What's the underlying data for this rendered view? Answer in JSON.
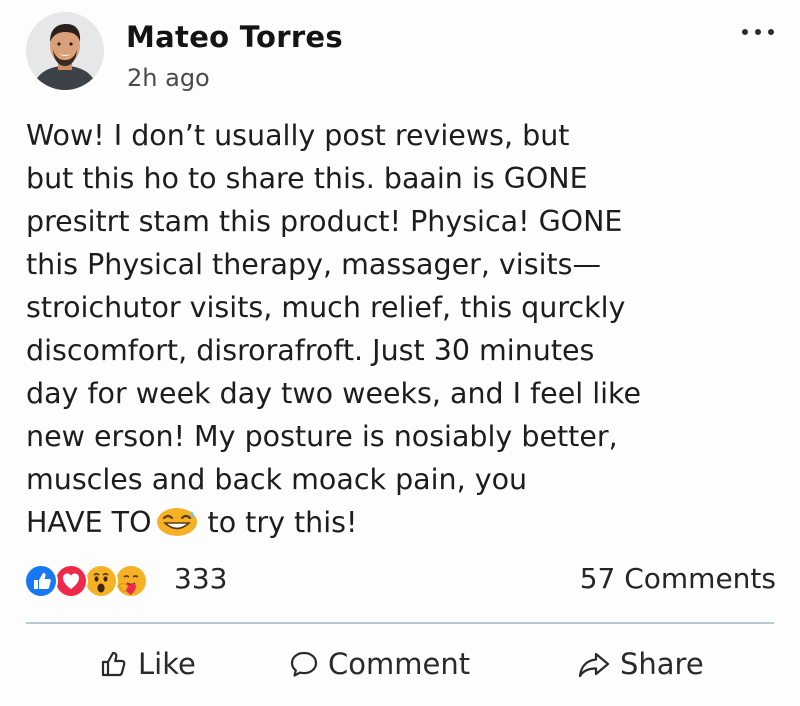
{
  "post": {
    "author": "Mateo Torres",
    "timestamp": "2h ago",
    "body_lines": [
      "Wow! I don’t usually post reviews, but",
      "but this ho to share this. baain is GONE",
      "presitrt stam this product! Physica! GONE",
      "this Physical therapy, massager, visits—",
      "stroichutor visits, much relief, this qurckly",
      "discomfort, disrorafroft. Just 30 minutes",
      "day for week day two weeks, and I feel like",
      "new erson! My posture is nosiably better,",
      "muscles and back moack pain, you"
    ],
    "last_line_before_emoji": "HAVE TO",
    "last_line_after_emoji": "to try this!",
    "inline_emoji": "grinning-sweat-emoji"
  },
  "stats": {
    "reactions": [
      "like-icon",
      "love-icon",
      "wow-icon",
      "care-icon"
    ],
    "reaction_count": "333",
    "comments": "57 Comments"
  },
  "actions": {
    "like": "Like",
    "comment": "Comment",
    "share": "Share"
  },
  "colors": {
    "like_blue": "#1877F2",
    "love_red": "#F02849",
    "emoji_yellow": "#F7B125",
    "divider": "#B9C6D6"
  },
  "icons": {
    "more": "more-options-icon",
    "like": "thumbs-up-icon",
    "comment": "speech-bubble-icon",
    "share": "share-arrow-icon"
  }
}
